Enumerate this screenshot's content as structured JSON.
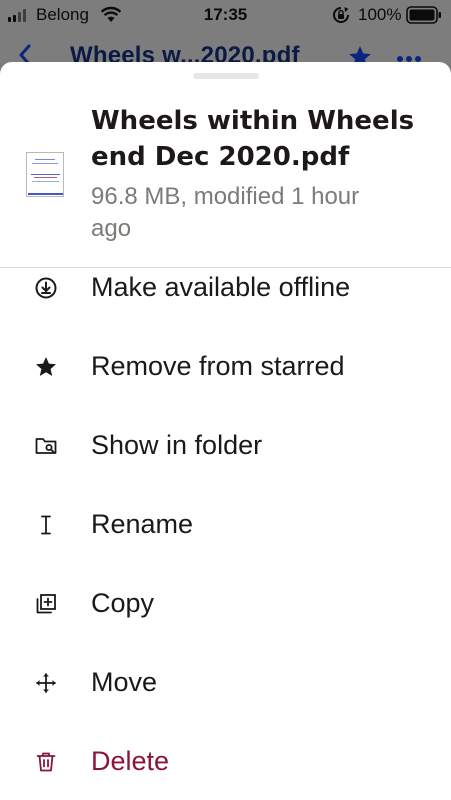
{
  "status_bar": {
    "carrier": "Belong",
    "time": "17:35",
    "battery": "100%"
  },
  "nav": {
    "title": "Wheels w...2020.pdf",
    "back_icon": "chevron-left-icon",
    "star_icon": "star-icon",
    "more_icon": "more-icon"
  },
  "file": {
    "name": "Wheels within Wheels end Dec 2020.pdf",
    "meta": "96.8 MB, modified 1 hour ago"
  },
  "menu": [
    {
      "label": "Make available offline",
      "icon": "download-circle-icon"
    },
    {
      "label": "Remove from starred",
      "icon": "star-icon"
    },
    {
      "label": "Show in folder",
      "icon": "folder-search-icon"
    },
    {
      "label": "Rename",
      "icon": "text-cursor-icon"
    },
    {
      "label": "Copy",
      "icon": "copy-icon"
    },
    {
      "label": "Move",
      "icon": "move-icon"
    },
    {
      "label": "Delete",
      "icon": "trash-icon"
    }
  ],
  "colors": {
    "accent": "#0d2481",
    "danger": "#8a1538",
    "text": "#1e1919",
    "muted": "#7d7a77",
    "overlay": "#7d7d7d"
  }
}
